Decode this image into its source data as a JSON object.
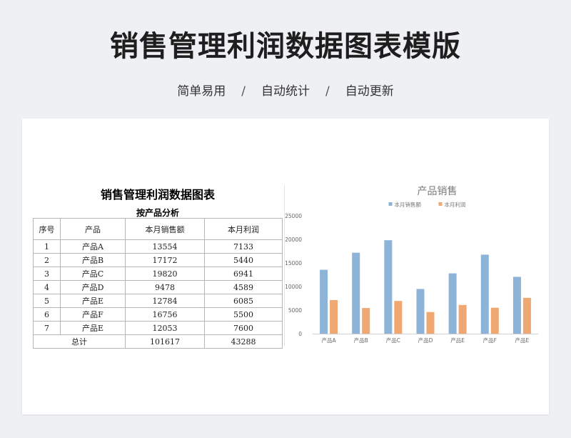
{
  "header": {
    "title": "销售管理利润数据图表模版",
    "features": [
      "简单易用",
      "自动统计",
      "自动更新"
    ],
    "separator": "/"
  },
  "sheet": {
    "title": "销售管理利润数据图表",
    "subtitle": "按产品分析",
    "columns": [
      "序号",
      "产品",
      "本月销售额",
      "本月利润"
    ],
    "rows": [
      [
        "1",
        "产品A",
        "13554",
        "7133"
      ],
      [
        "2",
        "产品B",
        "17172",
        "5440"
      ],
      [
        "3",
        "产品C",
        "19820",
        "6941"
      ],
      [
        "4",
        "产品D",
        "9478",
        "4589"
      ],
      [
        "5",
        "产品E",
        "12784",
        "6085"
      ],
      [
        "6",
        "产品F",
        "16756",
        "5500"
      ],
      [
        "7",
        "产品E",
        "12053",
        "7600"
      ]
    ],
    "total": {
      "label": "总计",
      "sales": "101617",
      "profit": "43288"
    }
  },
  "chart_data": {
    "type": "bar",
    "title": "产品销售",
    "categories": [
      "产品A",
      "产品B",
      "产品C",
      "产品D",
      "产品E",
      "产品F",
      "产品E"
    ],
    "series": [
      {
        "name": "本月销售额",
        "values": [
          13554,
          17172,
          19820,
          9478,
          12784,
          16756,
          12053
        ],
        "color": "#8db3d9"
      },
      {
        "name": "本月利润",
        "values": [
          7133,
          5440,
          6941,
          4589,
          6085,
          5500,
          7600
        ],
        "color": "#f0a873"
      }
    ],
    "ylim": [
      0,
      25000
    ],
    "yticks": [
      0,
      5000,
      10000,
      15000,
      20000,
      25000
    ],
    "grid": false,
    "legend": "top"
  }
}
